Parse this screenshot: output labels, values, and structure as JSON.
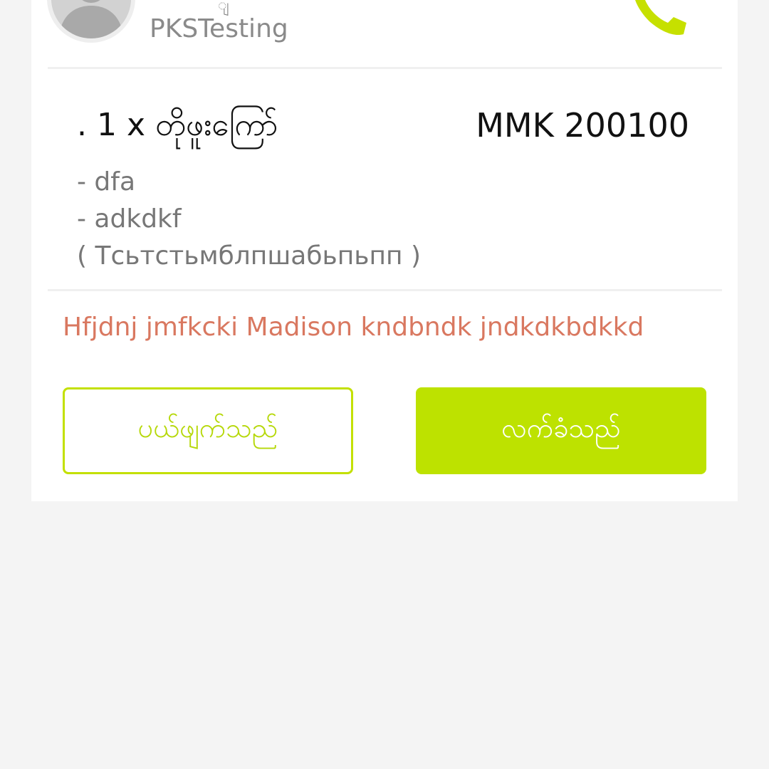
{
  "order": {
    "customer": {
      "name_fragment": "ျ",
      "name": "PKSTesting"
    },
    "item": {
      "line": ". 1 x တိုဖူးကြော်",
      "price": "MMK 200100",
      "options": [
        "- dfa",
        "- adkdkf",
        "( Тсьтстьмблпшабьпьпп )"
      ]
    },
    "note": "Hfjdnj jmfkcki Madison kndbndk jndkdkbdkkd",
    "actions": {
      "reject_label": "ပယ်ဖျက်သည်",
      "accept_label": "လက်ခံသည်"
    },
    "colors": {
      "accent": "#bde200",
      "note": "#d97860"
    },
    "icons": {
      "avatar": "user-avatar-icon",
      "phone": "phone-icon"
    }
  }
}
